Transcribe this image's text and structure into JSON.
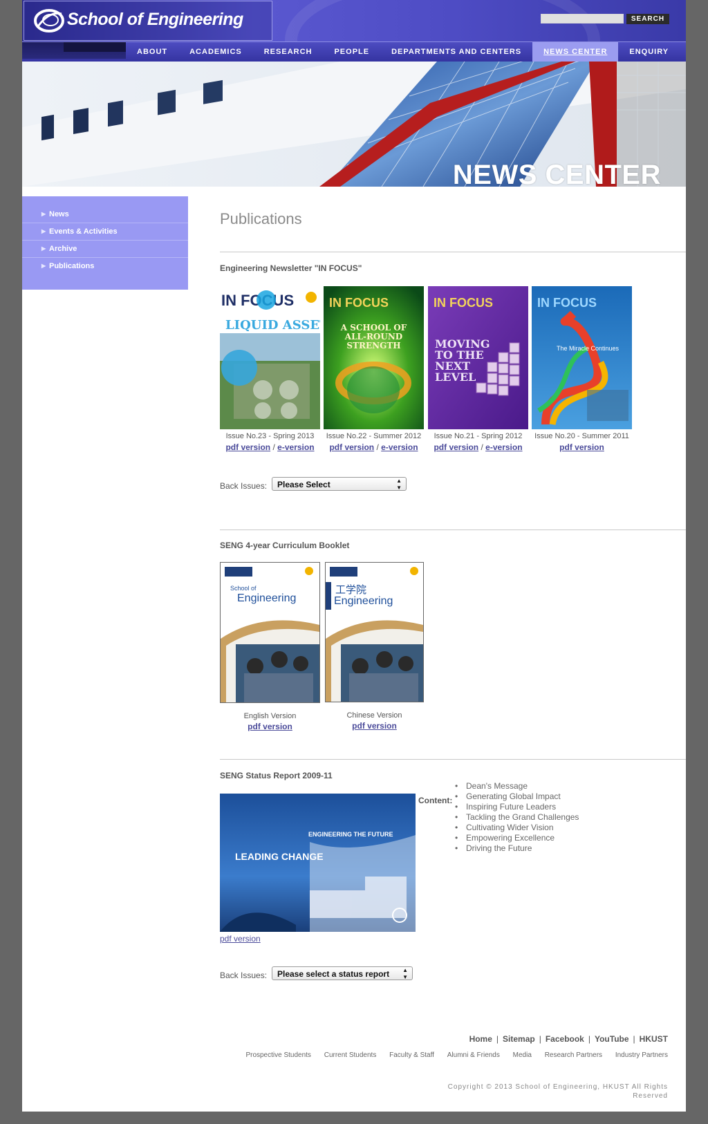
{
  "header": {
    "logo_text": "School of Engineering",
    "search_button": "SEARCH",
    "search_value": ""
  },
  "nav": {
    "items": [
      {
        "label": "ABOUT"
      },
      {
        "label": "ACADEMICS"
      },
      {
        "label": "RESEARCH"
      },
      {
        "label": "PEOPLE"
      },
      {
        "label": "DEPARTMENTS AND CENTERS"
      },
      {
        "label": "NEWS CENTER"
      },
      {
        "label": "ENQUIRY"
      }
    ],
    "active": "NEWS CENTER"
  },
  "banner": {
    "title": "NEWS CENTER"
  },
  "sidebar": {
    "items": [
      {
        "label": "News"
      },
      {
        "label": "Events & Activities"
      },
      {
        "label": "Archive"
      },
      {
        "label": "Publications"
      }
    ]
  },
  "main": {
    "title": "Publications",
    "newsletter": {
      "title": "Engineering Newsletter \"IN FOCUS\"",
      "issues": [
        {
          "caption": "Issue No.23 - Spring 2013",
          "pdf": "pdf version",
          "sep": "/",
          "e": "e-version",
          "cover_headline": "LIQUID ASSET"
        },
        {
          "caption": "Issue No.22 - Summer 2012",
          "pdf": "pdf version",
          "sep": "/",
          "e": "e-version",
          "cover_headline": "A SCHOOL OF ALL-ROUND STRENGTH"
        },
        {
          "caption": "Issue No.21 - Spring 2012",
          "pdf": "pdf version",
          "sep": "/",
          "e": "e-version",
          "cover_headline": "MOVING TO THE NEXT LEVEL"
        },
        {
          "caption": "Issue No.20 - Summer 2011",
          "pdf": "pdf version",
          "cover_headline": "The Miracle Continues"
        }
      ],
      "back_label": "Back Issues:",
      "back_select": "Please Select"
    },
    "curriculum": {
      "title": "SENG 4-year Curriculum Booklet",
      "versions": [
        {
          "caption": "English Version",
          "pdf": "pdf version",
          "cover_title": "Engineering"
        },
        {
          "caption": "Chinese Version",
          "pdf": "pdf version",
          "cover_title": "Engineering"
        }
      ]
    },
    "status": {
      "title": "SENG Status Report 2009-11",
      "pdf": "pdf version",
      "cover_line1": "ENGINEERING THE FUTURE",
      "cover_line2": "LEADING CHANGE",
      "content_label": "Content:",
      "content_items": [
        "Dean's Message",
        "Generating Global Impact",
        "Inspiring Future Leaders",
        "Tackling the Grand Challenges",
        "Cultivating Wider Vision",
        "Empowering Excellence",
        "Driving the Future"
      ],
      "back_label": "Back Issues:",
      "back_select": "Please select a status report"
    }
  },
  "footer": {
    "links": [
      "Home",
      "Sitemap",
      "Facebook",
      "YouTube",
      "HKUST"
    ],
    "sub_links": [
      "Prospective Students",
      "Current Students",
      "Faculty & Staff",
      "Alumni & Friends",
      "Media",
      "Research Partners",
      "Industry Partners"
    ],
    "copyright": "Copyright © 2013 School of Engineering, HKUST    All Rights Reserved"
  },
  "colors": {
    "header": "#4e4cc4",
    "sidebar": "#9999f3",
    "link": "#4b4b9a",
    "backdrop": "#666666"
  }
}
